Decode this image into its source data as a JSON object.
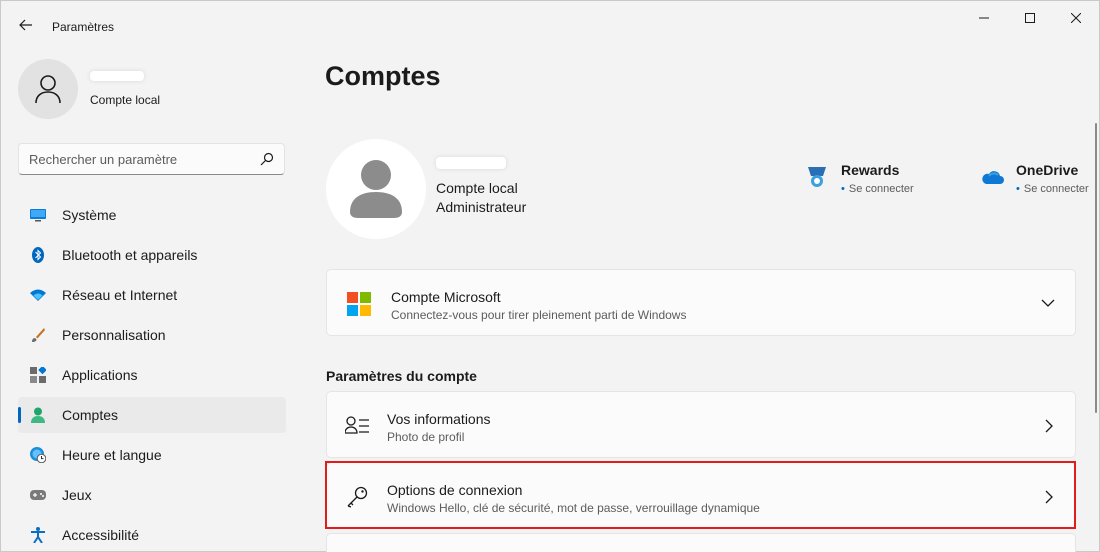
{
  "window": {
    "title": "Paramètres",
    "controls": [
      "minimize",
      "maximize",
      "close"
    ]
  },
  "sidebar": {
    "user": {
      "type": "Compte local"
    },
    "search": {
      "placeholder": "Rechercher un paramètre"
    },
    "items": [
      {
        "label": "Système",
        "icon": "monitor-icon"
      },
      {
        "label": "Bluetooth et appareils",
        "icon": "bluetooth-icon"
      },
      {
        "label": "Réseau et Internet",
        "icon": "wifi-icon"
      },
      {
        "label": "Personnalisation",
        "icon": "brush-icon"
      },
      {
        "label": "Applications",
        "icon": "apps-icon"
      },
      {
        "label": "Comptes",
        "icon": "person-icon",
        "active": true
      },
      {
        "label": "Heure et langue",
        "icon": "clock-globe-icon"
      },
      {
        "label": "Jeux",
        "icon": "gamepad-icon"
      },
      {
        "label": "Accessibilité",
        "icon": "accessibility-icon"
      }
    ]
  },
  "main": {
    "title": "Comptes",
    "profile": {
      "type": "Compte local",
      "role": "Administrateur"
    },
    "services": [
      {
        "title": "Rewards",
        "status": "Se connecter",
        "icon": "rewards-medal-icon"
      },
      {
        "title": "OneDrive",
        "status": "Se connecter",
        "icon": "onedrive-cloud-icon"
      }
    ],
    "microsoft_account": {
      "title": "Compte Microsoft",
      "subtitle": "Connectez-vous pour tirer pleinement parti de Windows"
    },
    "section_title": "Paramètres du compte",
    "rows": [
      {
        "title": "Vos informations",
        "subtitle": "Photo de profil",
        "icon": "user-info-icon"
      },
      {
        "title": "Options de connexion",
        "subtitle": "Windows Hello, clé de sécurité, mot de passe, verrouillage dynamique",
        "icon": "key-icon",
        "highlighted": true
      }
    ]
  },
  "colors": {
    "accent": "#0067c0",
    "highlight": "#e21b1b",
    "background": "#f3f3f3",
    "card": "#fbfbfb"
  }
}
